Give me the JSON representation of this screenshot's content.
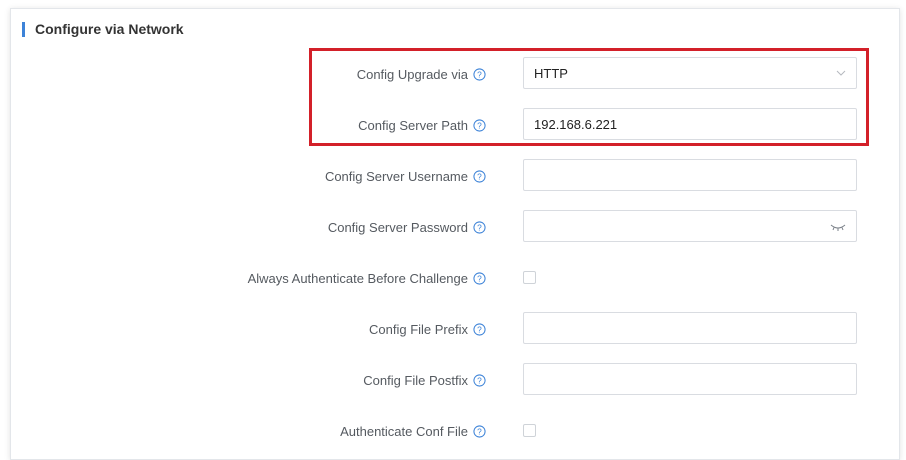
{
  "section": {
    "title": "Configure via Network"
  },
  "fields": {
    "config_upgrade_via": {
      "label": "Config Upgrade via",
      "value": "HTTP"
    },
    "config_server_path": {
      "label": "Config Server Path",
      "value": "192.168.6.221"
    },
    "config_server_username": {
      "label": "Config Server Username",
      "value": ""
    },
    "config_server_password": {
      "label": "Config Server Password",
      "value": ""
    },
    "always_authenticate": {
      "label": "Always Authenticate Before Challenge",
      "checked": false
    },
    "config_file_prefix": {
      "label": "Config File Prefix",
      "value": ""
    },
    "config_file_postfix": {
      "label": "Config File Postfix",
      "value": ""
    },
    "authenticate_conf_file": {
      "label": "Authenticate Conf File",
      "checked": false
    }
  },
  "icons": {
    "help": "help-circle-icon",
    "chevron": "chevron-down-icon",
    "password_toggle": "eye-closed-icon"
  },
  "colors": {
    "accent": "#3d83d8",
    "highlight": "#d32029",
    "help_icon": "#3d83d8"
  }
}
